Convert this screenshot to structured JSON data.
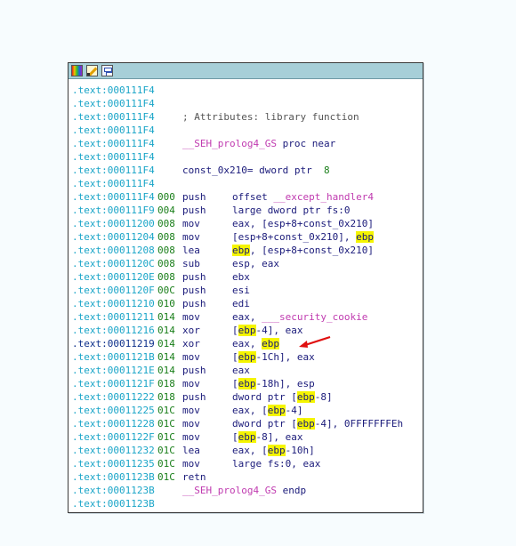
{
  "toolbar_icons": [
    "color-palette-icon",
    "pencil-icon",
    "graph-view-icon"
  ],
  "colors": {
    "address": "#1aa5c8",
    "address_current": "#0b2e8a",
    "stack_pointer": "#1a7f1a",
    "highlight": "#f5f500",
    "arrow": "#e01010",
    "titlebar": "#a7cfd8"
  },
  "lines": [
    {
      "addr": ".text:000111F4"
    },
    {
      "addr": ".text:000111F4"
    },
    {
      "addr": ".text:000111F4",
      "text": "; Attributes: library function"
    },
    {
      "addr": ".text:000111F4"
    },
    {
      "addr": ".text:000111F4",
      "text": "__SEH_prolog4_GS proc near"
    },
    {
      "addr": ".text:000111F4"
    },
    {
      "addr": ".text:000111F4",
      "text": "const_0x210= dword ptr  8"
    },
    {
      "addr": ".text:000111F4"
    },
    {
      "addr": ".text:000111F4",
      "sp": "000",
      "mn": "push",
      "op": "offset __except_handler4"
    },
    {
      "addr": ".text:000111F9",
      "sp": "004",
      "mn": "push",
      "op": "large dword ptr fs:0"
    },
    {
      "addr": ".text:00011200",
      "sp": "008",
      "mn": "mov",
      "op": "eax, [esp+8+const_0x210]"
    },
    {
      "addr": ".text:00011204",
      "sp": "008",
      "mn": "mov",
      "op": "[esp+8+const_0x210], ebp"
    },
    {
      "addr": ".text:00011208",
      "sp": "008",
      "mn": "lea",
      "op": "ebp, [esp+8+const_0x210]"
    },
    {
      "addr": ".text:0001120C",
      "sp": "008",
      "mn": "sub",
      "op": "esp, eax"
    },
    {
      "addr": ".text:0001120E",
      "sp": "008",
      "mn": "push",
      "op": "ebx"
    },
    {
      "addr": ".text:0001120F",
      "sp": "00C",
      "mn": "push",
      "op": "esi"
    },
    {
      "addr": ".text:00011210",
      "sp": "010",
      "mn": "push",
      "op": "edi"
    },
    {
      "addr": ".text:00011211",
      "sp": "014",
      "mn": "mov",
      "op": "eax, ___security_cookie"
    },
    {
      "addr": ".text:00011216",
      "sp": "014",
      "mn": "xor",
      "op": "[ebp-4], eax"
    },
    {
      "addr": ".text:00011219",
      "sp": "014",
      "mn": "xor",
      "op": "eax, ebp"
    },
    {
      "addr": ".text:0001121B",
      "sp": "014",
      "mn": "mov",
      "op": "[ebp-1Ch], eax"
    },
    {
      "addr": ".text:0001121E",
      "sp": "014",
      "mn": "push",
      "op": "eax"
    },
    {
      "addr": ".text:0001121F",
      "sp": "018",
      "mn": "mov",
      "op": "[ebp-18h], esp"
    },
    {
      "addr": ".text:00011222",
      "sp": "018",
      "mn": "push",
      "op": "dword ptr [ebp-8]"
    },
    {
      "addr": ".text:00011225",
      "sp": "01C",
      "mn": "mov",
      "op": "eax, [ebp-4]"
    },
    {
      "addr": ".text:00011228",
      "sp": "01C",
      "mn": "mov",
      "op": "dword ptr [ebp-4], 0FFFFFFFEh"
    },
    {
      "addr": ".text:0001122F",
      "sp": "01C",
      "mn": "mov",
      "op": "[ebp-8], eax"
    },
    {
      "addr": ".text:00011232",
      "sp": "01C",
      "mn": "lea",
      "op": "eax, [ebp-10h]"
    },
    {
      "addr": ".text:00011235",
      "sp": "01C",
      "mn": "mov",
      "op": "large fs:0, eax"
    },
    {
      "addr": ".text:0001123B",
      "sp": "01C",
      "mn": "retn"
    },
    {
      "addr": ".text:0001123B",
      "text": "__SEH_prolog4_GS endp"
    },
    {
      "addr": ".text:0001123B"
    }
  ]
}
